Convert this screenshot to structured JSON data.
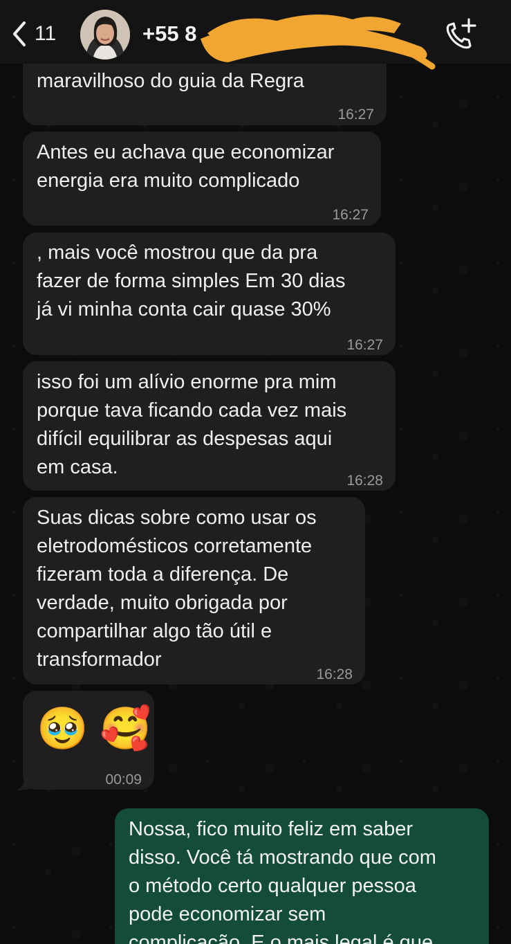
{
  "header": {
    "back_count": "11",
    "contact_name": "+55 8"
  },
  "messages": [
    {
      "text": "maravilhoso do guia da Regra",
      "time": "16:27"
    },
    {
      "text": "Antes eu achava que economizar\nenergia era muito complicado",
      "time": "16:27"
    },
    {
      "text": ", mais você mostrou que da pra\nfazer de forma simples Em 30 dias\njá vi minha conta cair quase 30%",
      "time": "16:27"
    },
    {
      "text": "isso foi um alívio enorme pra mim\nporque tava ficando cada vez mais\ndifícil equilibrar as despesas aqui\nem casa.",
      "time": "16:28"
    },
    {
      "text": "Suas dicas sobre como usar os\neletrodomésticos corretamente\nfizeram toda a diferença. De\nverdade, muito obrigada por\ncompartilhar algo tão útil e\ntransformador",
      "time": "16:28"
    },
    {
      "text": "🥹 🥰",
      "time": "00:09"
    },
    {
      "text": "Nossa, fico muito feliz em saber\ndisso. Você tá mostrando que com\no método certo qualquer pessoa\npode economizar sem\ncomplicação. E o mais legal é que",
      "time": ""
    }
  ],
  "icons": {
    "back": "chevron-left-icon",
    "call": "phone-plus-icon"
  },
  "colors": {
    "incoming_bubble": "#1f1f1f",
    "outgoing_bubble": "#144d37",
    "redaction": "#f0a630"
  }
}
